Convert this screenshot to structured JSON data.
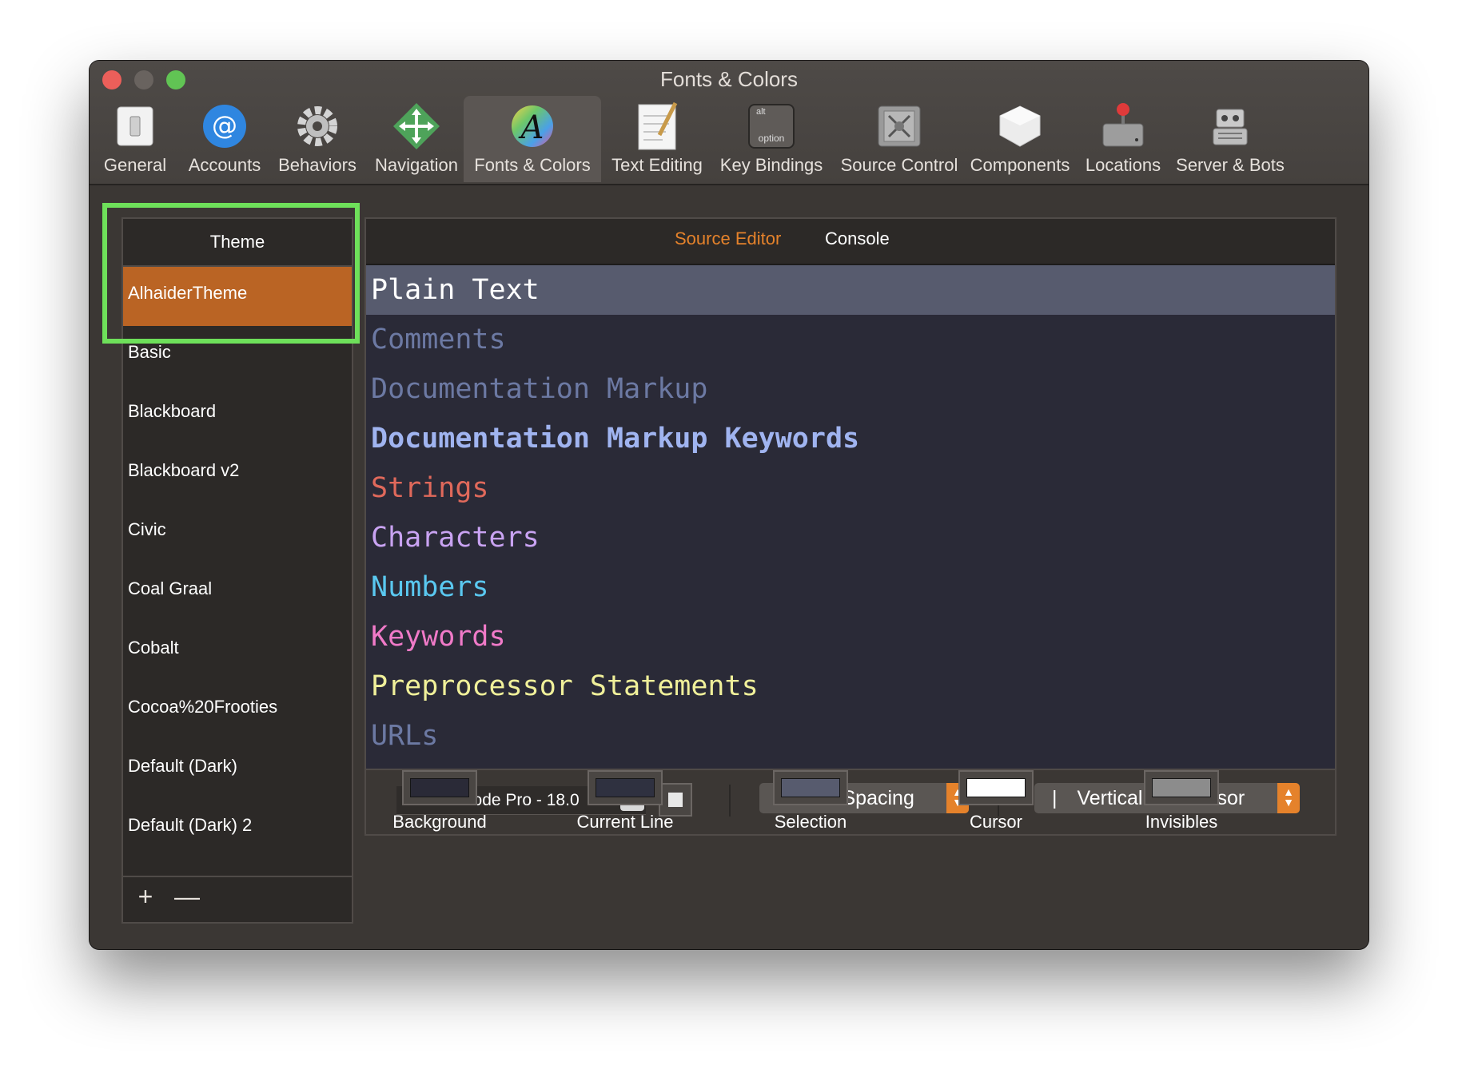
{
  "window": {
    "title": "Fonts & Colors"
  },
  "toolbar": {
    "items": [
      {
        "label": "General",
        "icon": "switch-icon"
      },
      {
        "label": "Accounts",
        "icon": "at-icon"
      },
      {
        "label": "Behaviors",
        "icon": "gear-icon"
      },
      {
        "label": "Navigation",
        "icon": "arrows-icon"
      },
      {
        "label": "Fonts & Colors",
        "icon": "font-icon",
        "selected": true
      },
      {
        "label": "Text Editing",
        "icon": "notepad-icon"
      },
      {
        "label": "Key Bindings",
        "icon": "option-key-icon",
        "key_top": "alt",
        "key_bottom": "option"
      },
      {
        "label": "Source Control",
        "icon": "vault-icon"
      },
      {
        "label": "Components",
        "icon": "box-icon"
      },
      {
        "label": "Locations",
        "icon": "drive-icon"
      },
      {
        "label": "Server & Bots",
        "icon": "robot-icon"
      }
    ]
  },
  "themes": {
    "header": "Theme",
    "items": [
      "AlhaiderTheme",
      "Basic",
      "Blackboard",
      "Blackboard v2",
      "Civic",
      "Coal Graal",
      "Cobalt",
      "Cocoa%20Frooties",
      "Default (Dark)",
      "Default (Dark) 2"
    ],
    "selected": "AlhaiderTheme",
    "add_label": "+",
    "remove_label": "—"
  },
  "editor": {
    "tabs": {
      "source_editor": "Source Editor",
      "console": "Console"
    },
    "tokens": [
      {
        "label": "Plain Text",
        "color": "#ffffff",
        "bold": false,
        "selected": true
      },
      {
        "label": "Comments",
        "color": "#6c79a3",
        "bold": false
      },
      {
        "label": "Documentation Markup",
        "color": "#6c79a3",
        "bold": false
      },
      {
        "label": "Documentation Markup Keywords",
        "color": "#a0b4f0",
        "bold": true
      },
      {
        "label": "Strings",
        "color": "#e0695b",
        "bold": false
      },
      {
        "label": "Characters",
        "color": "#c9a3f2",
        "bold": false
      },
      {
        "label": "Numbers",
        "color": "#5ac8f0",
        "bold": false
      },
      {
        "label": "Keywords",
        "color": "#f07ac8",
        "bold": false
      },
      {
        "label": "Preprocessor Statements",
        "color": "#f0f09a",
        "bold": false
      },
      {
        "label": "URLs",
        "color": "#6c79a3",
        "bold": false
      }
    ],
    "font": "Source Code Pro - 18.0",
    "font_button": "T",
    "spacing": "Normal Spacing",
    "cursor_style": "Vertical Bar Cursor",
    "cursor_glyph": "|"
  },
  "color_wells": [
    {
      "label": "Background",
      "color": "#2a2a37"
    },
    {
      "label": "Current Line",
      "color": "#2f3140"
    },
    {
      "label": "Selection",
      "color": "#575b6e"
    },
    {
      "label": "Cursor",
      "color": "#ffffff"
    },
    {
      "label": "Invisibles",
      "color": "#8c8c8c"
    }
  ],
  "colors": {
    "accent": "#e5822b",
    "selection": "#ba6424",
    "highlight": "#6ee05a"
  }
}
